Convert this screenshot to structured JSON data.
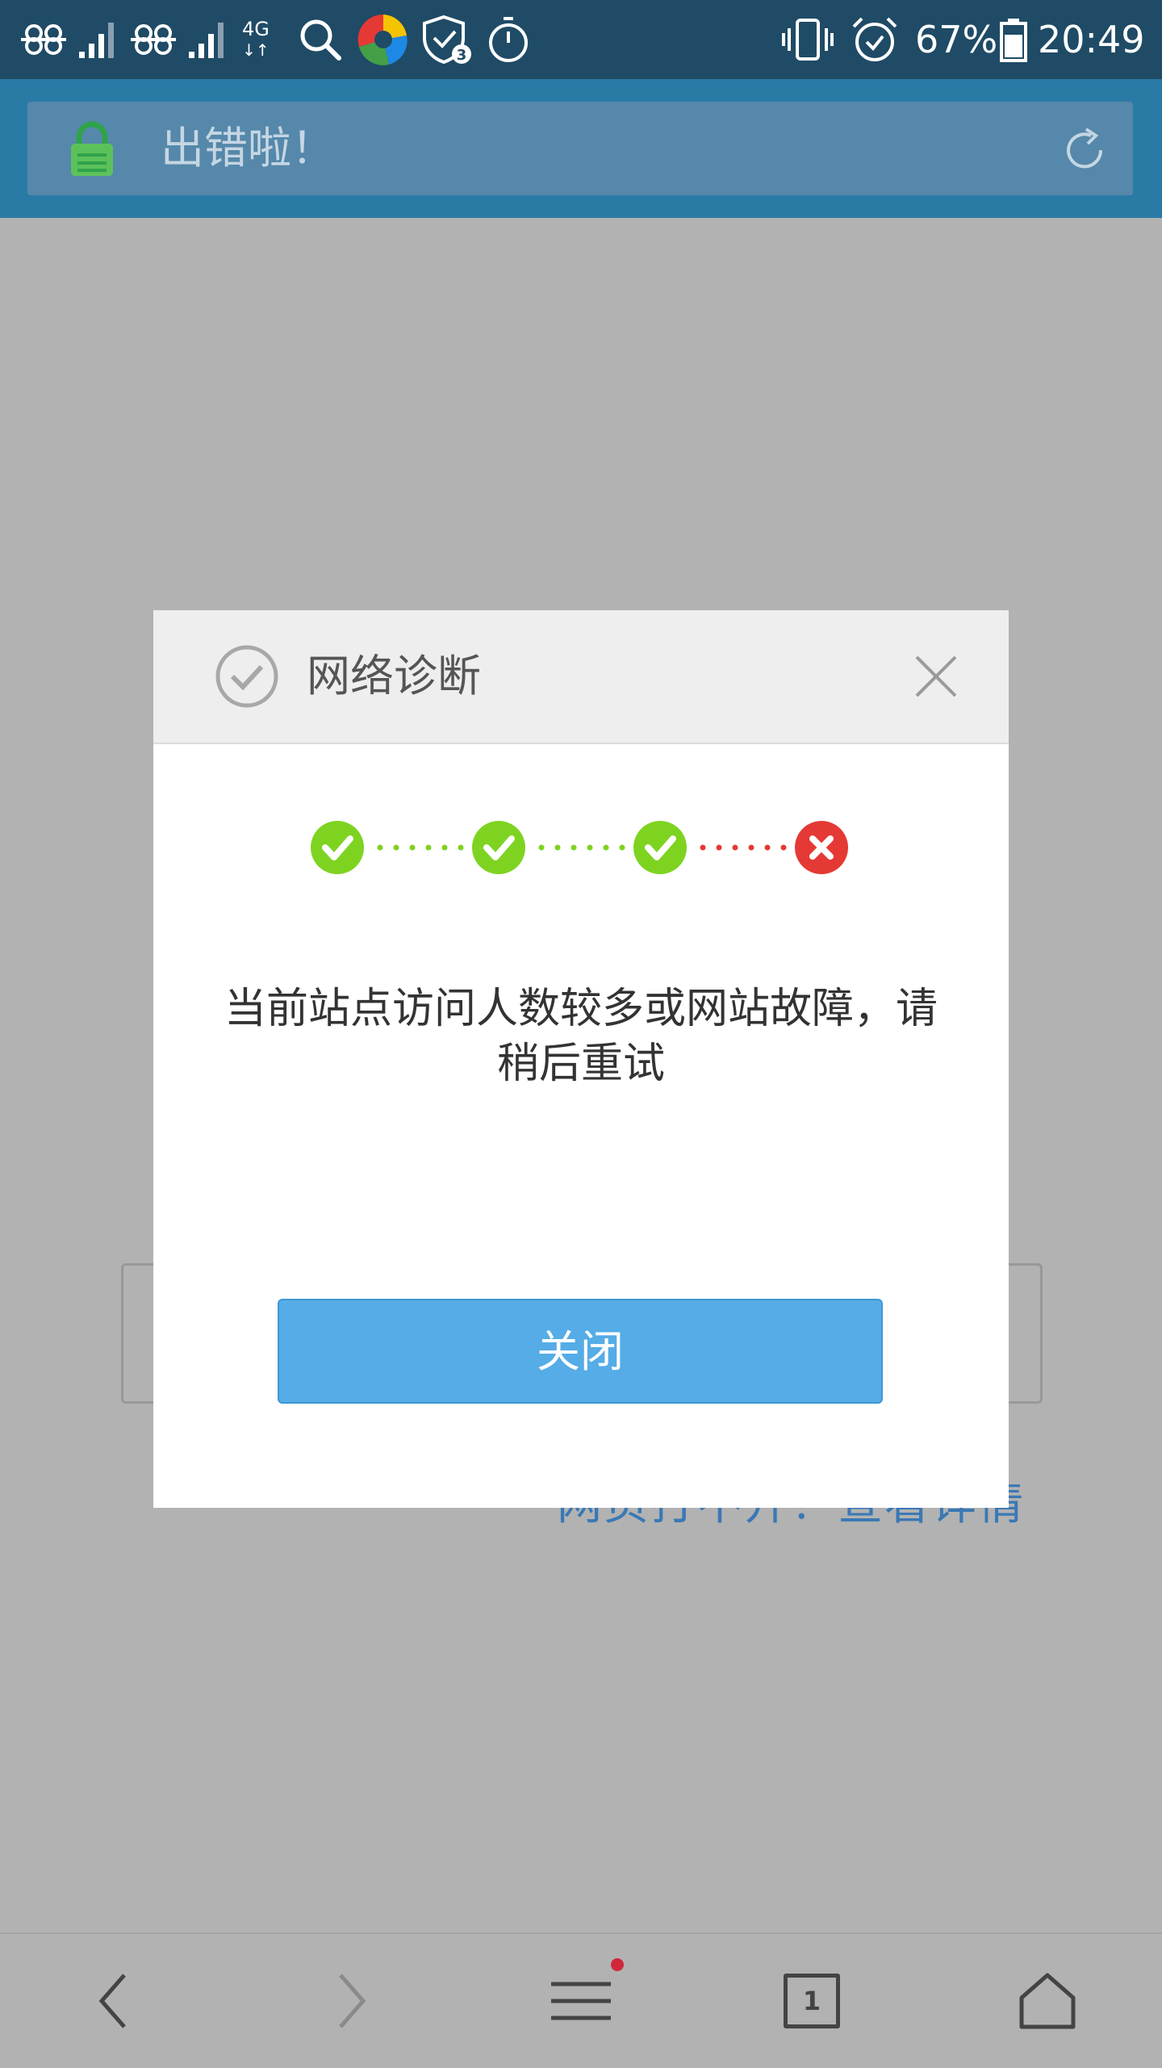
{
  "status_bar": {
    "network_type": "4G",
    "battery_percent": "67%",
    "time": "20:49"
  },
  "browser": {
    "page_title": "出错啦！"
  },
  "background_page": {
    "link_text": "网页打不开？查看详情"
  },
  "dialog": {
    "title": "网络诊断",
    "steps": [
      {
        "status": "success",
        "color": "#7ed321"
      },
      {
        "status": "success",
        "color": "#7ed321"
      },
      {
        "status": "success",
        "color": "#7ed321"
      },
      {
        "status": "error",
        "color": "#e53935"
      }
    ],
    "message": "当前站点访问人数较多或网站故障，请稍后重试",
    "close_button_label": "关闭"
  },
  "bottom_nav": {
    "tab_count": "1"
  },
  "colors": {
    "accent": "#55ace6",
    "success": "#7ed321",
    "error": "#e53935",
    "header": "#2a7aa6"
  }
}
